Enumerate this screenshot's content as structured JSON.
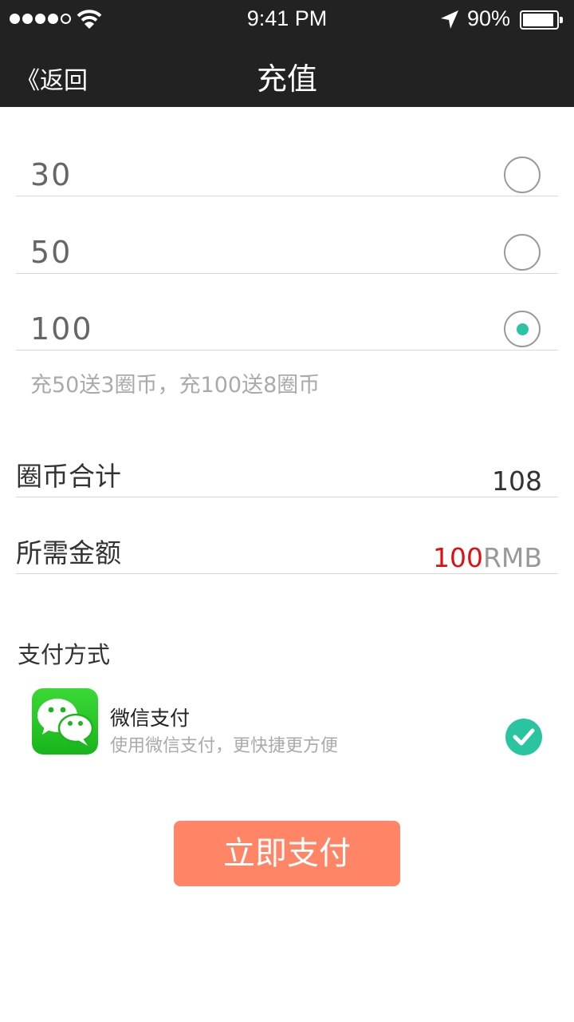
{
  "status_bar": {
    "time": "9:41 PM",
    "battery": "90%",
    "signal_bars_filled": 4,
    "signal_bars_total": 5,
    "icons": [
      "wifi-icon",
      "location-arrow-icon",
      "battery-icon"
    ]
  },
  "nav": {
    "back_label": "《返回",
    "title": "充值"
  },
  "options": [
    {
      "amount": "30",
      "selected": false
    },
    {
      "amount": "50",
      "selected": false
    },
    {
      "amount": "100",
      "selected": true
    }
  ],
  "promo_text": "充50送3圈币，充100送8圈币",
  "coin_total": {
    "label": "圈币合计",
    "value": "108"
  },
  "amount_due": {
    "label": "所需金额",
    "value": "100",
    "unit": "RMB"
  },
  "payment": {
    "section_label": "支付方式",
    "method_name": "微信支付",
    "method_desc": "使用微信支付，更快捷更方便",
    "selected": true
  },
  "pay_button": "立即支付",
  "colors": {
    "bar_bg": "#222222",
    "accent_teal": "#2bc4a1",
    "pay_button": "#ff8566",
    "amount_red": "#e01010",
    "wechat_green": "#1fbf24"
  }
}
